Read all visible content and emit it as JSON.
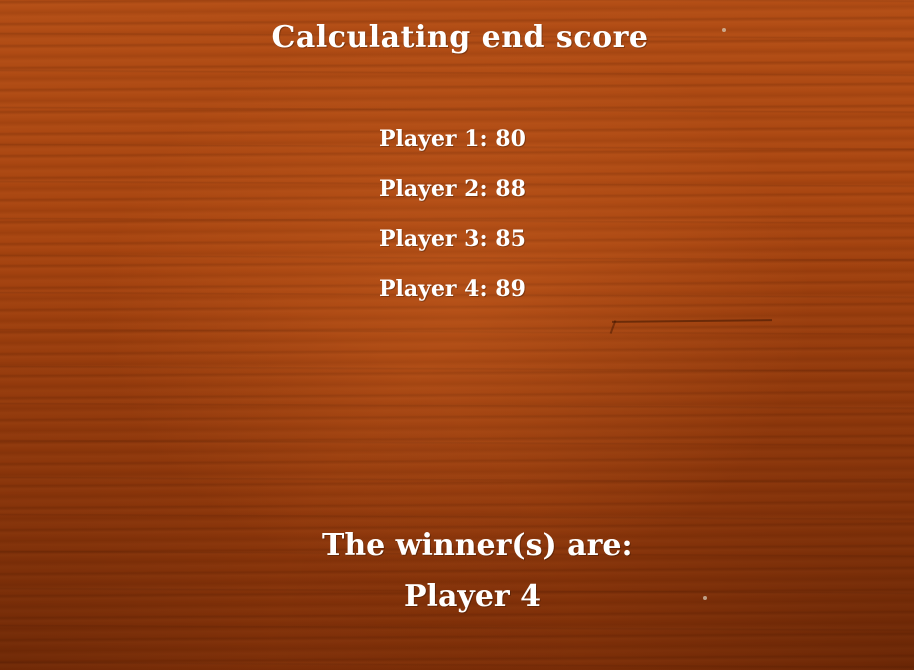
{
  "screen": {
    "title": "Calculating end score",
    "scores": [
      {
        "text": "Player 1: 80"
      },
      {
        "text": "Player 2: 88"
      },
      {
        "text": "Player 3: 85"
      },
      {
        "text": "Player 4: 89"
      }
    ],
    "winner_label": "The winner(s) are:",
    "winners": "Player 4"
  },
  "theme": {
    "background": "#a5430f",
    "text_color": "#ffffff"
  }
}
